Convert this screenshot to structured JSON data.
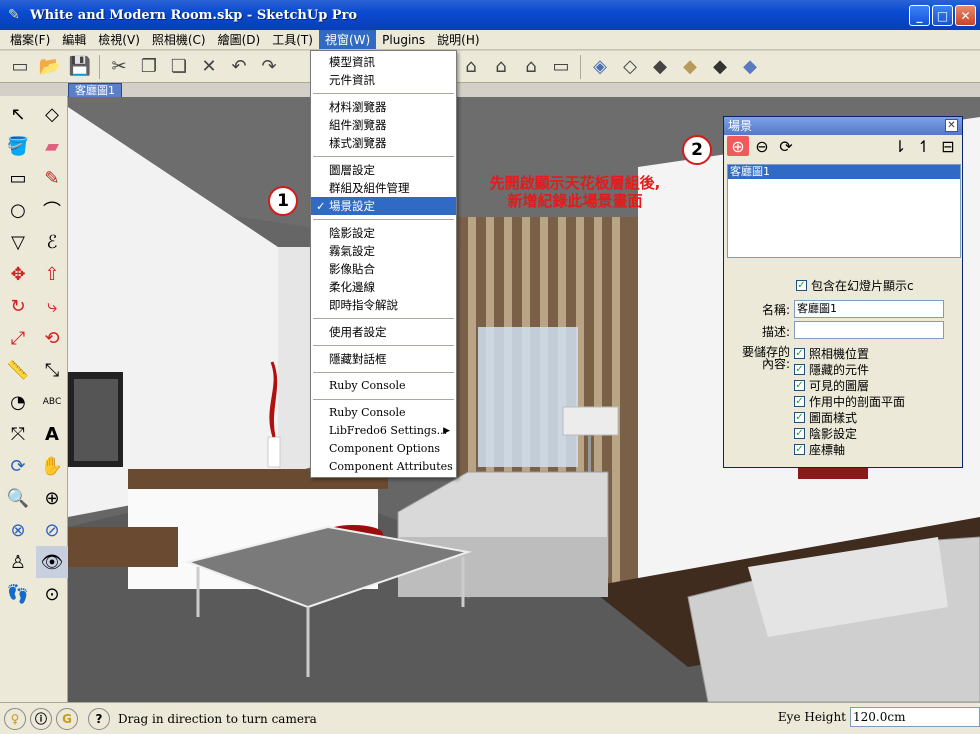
{
  "window": {
    "title": "White and Modern Room.skp - SketchUp Pro",
    "min": "_",
    "max": "□",
    "close": "✕"
  },
  "menubar": [
    "檔案(F)",
    "編輯",
    "檢視(V)",
    "照相機(C)",
    "繪圖(D)",
    "工具(T)",
    "視窗(W)",
    "Plugins",
    "說明(H)"
  ],
  "scene_tab": "客廳圖1",
  "dropdown": {
    "group1": [
      "模型資訊",
      "元件資訊"
    ],
    "group2": [
      "材料瀏覽器",
      "組件瀏覽器",
      "樣式瀏覽器"
    ],
    "group3": [
      "圖層設定",
      "群組及組件管理",
      "場景設定"
    ],
    "group4": [
      "陰影設定",
      "霧氣設定",
      "影像貼合",
      "柔化邊線",
      "即時指令解說"
    ],
    "group5": [
      "使用者設定"
    ],
    "group6": [
      "隱藏對話框"
    ],
    "group7": [
      "Ruby Console"
    ],
    "group8": [
      "Ruby Console",
      "LibFredo6 Settings...",
      "Component Options",
      "Component Attributes"
    ],
    "selected": "場景設定",
    "check": "✓",
    "submenu_arrow": "▶"
  },
  "annotation": {
    "badge1": "1",
    "badge2": "2",
    "note_line1": "先開啟顯示天花板層組後,",
    "note_line2": "新增紀錄此場景畫面"
  },
  "scenes_panel": {
    "title": "場景",
    "close": "✕",
    "list": [
      "客廳圖1"
    ],
    "include_animation": "包含在幻燈片顯示c",
    "name_label": "名稱:",
    "name_value": "客廳圖1",
    "desc_label": "描述:",
    "desc_value": "",
    "save_label_1": "要儲存的",
    "save_label_2": "內容:",
    "properties": [
      "照相機位置",
      "隱藏的元件",
      "可見的圖層",
      "作用中的剖面平面",
      "圖面樣式",
      "陰影設定",
      "座標軸"
    ]
  },
  "status": {
    "message": "Drag in direction to turn camera",
    "eye_height_label": "Eye Height",
    "eye_height_value": "120.0cm"
  },
  "colors": {
    "title_bar": "#0a4bd0",
    "menu_selected": "#316ac5",
    "annotation_red": "#e31b1b"
  }
}
